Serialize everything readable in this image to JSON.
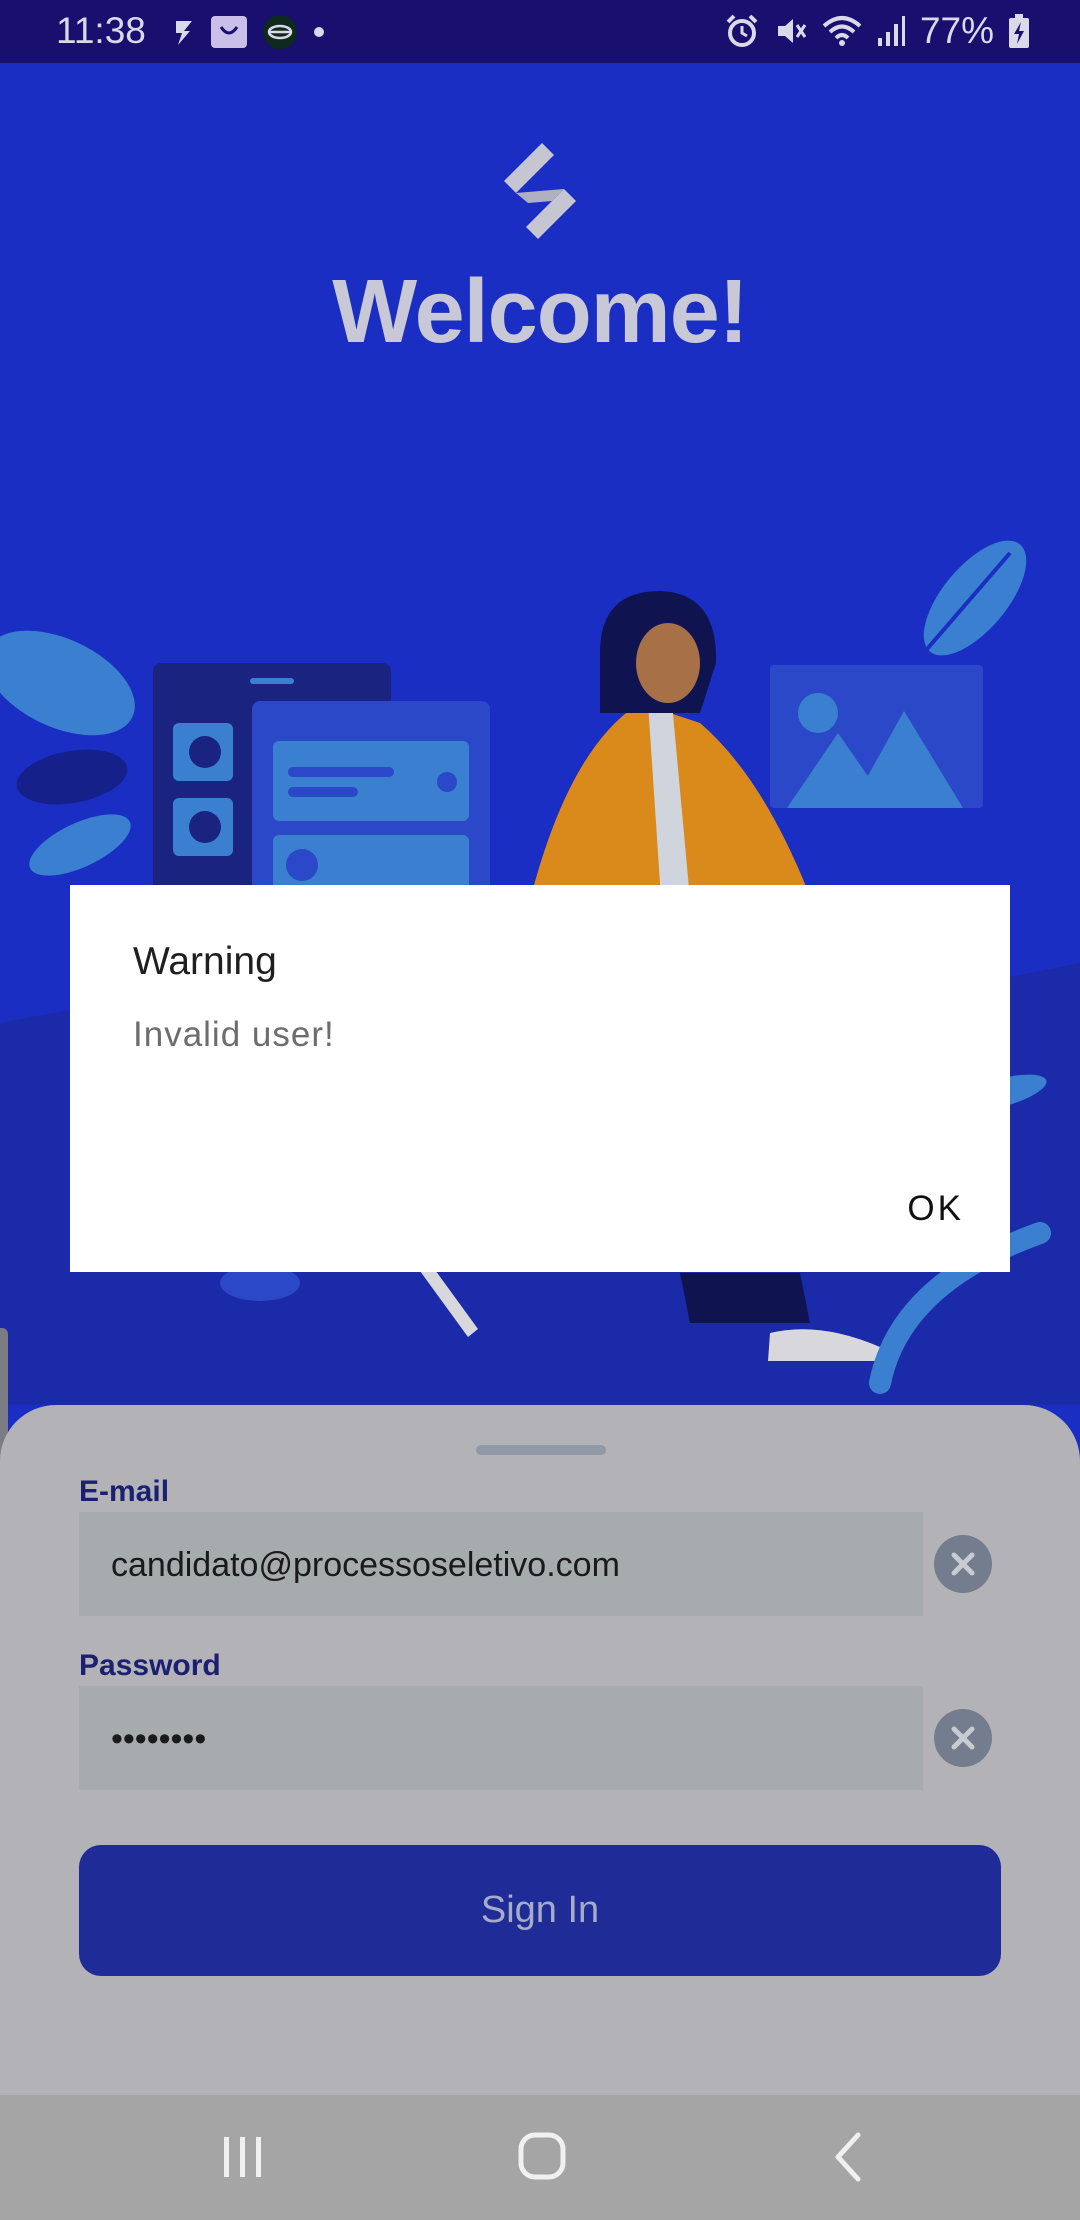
{
  "status_bar": {
    "time": "11:38",
    "battery": "77%"
  },
  "welcome": {
    "title": "Welcome!"
  },
  "dialog": {
    "title": "Warning",
    "message": "Invalid user!",
    "ok_label": "OK"
  },
  "form": {
    "email_label": "E-mail",
    "email_value": "candidato@processoseletivo.com",
    "password_label": "Password",
    "password_value": "••••••••",
    "sign_in_label": "Sign In"
  },
  "icons": {
    "logo": "logo-icon",
    "clear": "clear-icon",
    "nav": [
      "recent-apps-icon",
      "home-icon",
      "back-icon"
    ]
  },
  "colors": {
    "background": "#1a2ec4",
    "status_bar": "#180f6e",
    "button": "#1f2c98",
    "sheet": "#b3b3b7"
  }
}
